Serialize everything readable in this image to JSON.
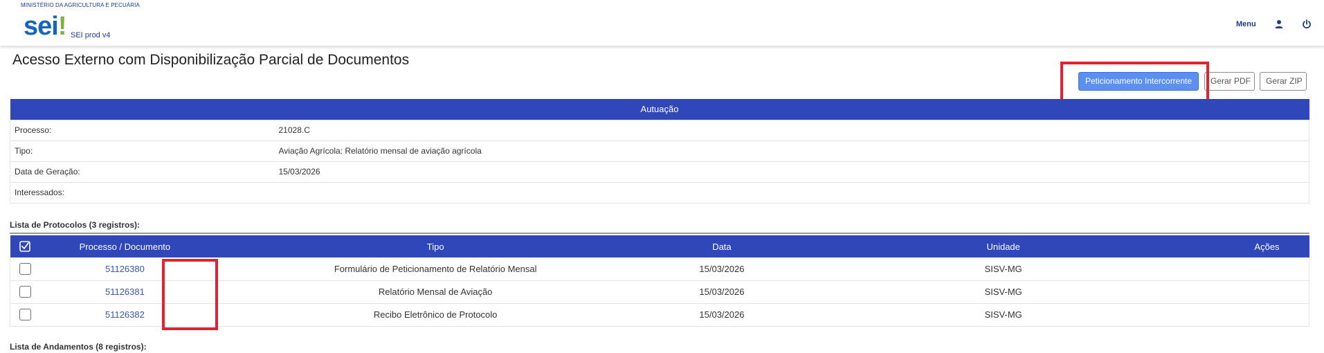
{
  "header": {
    "ministry": "MINISTÉRIO DA AGRICULTURA E PECUÁRIA",
    "logo_main": "sei",
    "logo_accent": "!",
    "system_name": "SEI prod v4",
    "menu_label": "Menu",
    "user_icon": "user-icon",
    "power_icon": "power-icon"
  },
  "page": {
    "title": "Acesso Externo com Disponibilização Parcial de Documentos"
  },
  "actions": {
    "peticionamento_label": "Peticionamento Intercorrente",
    "gerar_pdf_label": "Gerar PDF",
    "gerar_zip_label": "Gerar ZIP"
  },
  "autuacao": {
    "heading": "Autuação",
    "rows": [
      {
        "label": "Processo:",
        "value": "21028.C"
      },
      {
        "label": "Tipo:",
        "value": "Aviação Agrícola: Relatório mensal de aviação agrícola"
      },
      {
        "label": "Data de Geração:",
        "value": "15/03/2026"
      },
      {
        "label": "Interessados:",
        "value": ""
      }
    ]
  },
  "protocolos": {
    "section_label": "Lista de Protocolos (3 registros):",
    "columns": [
      "Processo / Documento",
      "Tipo",
      "Data",
      "Unidade",
      "Ações"
    ],
    "rows": [
      {
        "documento": "51126380",
        "tipo": "Formulário de Peticionamento de Relatório Mensal",
        "data": "15/03/2026",
        "unidade": "SISV-MG"
      },
      {
        "documento": "51126381",
        "tipo": "Relatório Mensal de Aviação",
        "data": "15/03/2026",
        "unidade": "SISV-MG"
      },
      {
        "documento": "51126382",
        "tipo": "Recibo Eletrônico de Protocolo",
        "data": "15/03/2026",
        "unidade": "SISV-MG"
      }
    ]
  },
  "andamentos": {
    "section_label": "Lista de Andamentos (8 registros):"
  },
  "colors": {
    "table_header": "#2f47b8",
    "primary_button": "#5b8ff0",
    "highlight": "#e0232e",
    "link": "#3a55b5"
  }
}
